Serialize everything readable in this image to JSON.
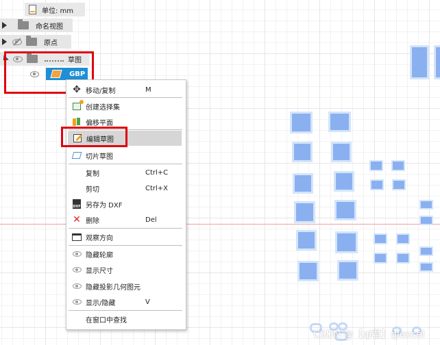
{
  "browser": {
    "units": "单位: mm",
    "named_views": "命名视图",
    "origin": "原点",
    "sketches": "草图",
    "sketch_item": "GBP"
  },
  "context_menu": {
    "items": [
      {
        "label": "移动/复制",
        "shortcut": "M",
        "icon": "move-icon"
      },
      {
        "label": "创建选择集",
        "shortcut": "",
        "icon": "selection-set-icon"
      },
      {
        "label": "偏移平面",
        "shortcut": "",
        "icon": "offset-plane-icon"
      },
      {
        "label": "编辑草图",
        "shortcut": "",
        "icon": "edit-sketch-icon"
      },
      {
        "label": "切片草图",
        "shortcut": "",
        "icon": "slice-sketch-icon"
      },
      {
        "label": "复制",
        "shortcut": "Ctrl+C",
        "icon": ""
      },
      {
        "label": "剪切",
        "shortcut": "Ctrl+X",
        "icon": ""
      },
      {
        "label": "另存为 DXF",
        "shortcut": "",
        "icon": "dxf-icon"
      },
      {
        "label": "删除",
        "shortcut": "Del",
        "icon": "delete-icon"
      },
      {
        "label": "观察方向",
        "shortcut": "",
        "icon": "look-at-icon"
      },
      {
        "label": "隐藏轮廓",
        "shortcut": "",
        "icon": "eye-icon"
      },
      {
        "label": "显示尺寸",
        "shortcut": "",
        "icon": "eye-icon"
      },
      {
        "label": "隐藏投影几何图元",
        "shortcut": "",
        "icon": "eye-icon"
      },
      {
        "label": "显示/隐藏",
        "shortcut": "V",
        "icon": "eye-icon"
      },
      {
        "label": "在窗口中查找",
        "shortcut": "",
        "icon": ""
      }
    ],
    "highlighted": "编辑草图"
  },
  "dxf_icon_text": "DXF",
  "watermark": "CSDN @【ql君】qlexcel",
  "colors": {
    "selection_blue": "#1e8fd6",
    "annotation_red": "#e0000c",
    "pad_fill": "#8ab0f0",
    "menu_highlight": "#d6d6d6"
  }
}
